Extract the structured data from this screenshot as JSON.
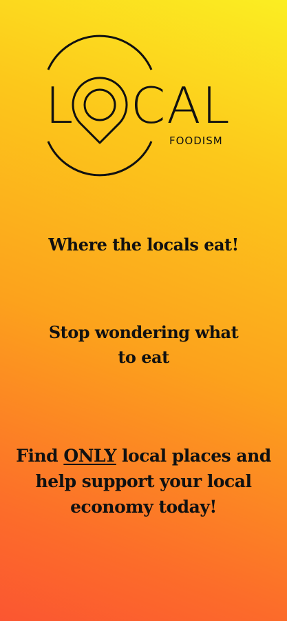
{
  "logo": {
    "letter_l": "L",
    "letters_cal": "CAL",
    "sub": "FOODISM"
  },
  "taglines": {
    "line1": "Where the locals eat!",
    "line2": "Stop wondering what to eat",
    "line3_pre": "Find ",
    "line3_emph": "ONLY",
    "line3_post": " local places and help support your local economy today!"
  },
  "colors": {
    "gradient_top": "#fbee22",
    "gradient_bottom": "#fb5631",
    "text": "#111111"
  },
  "icons": {
    "logo_o": "location-pin-icon"
  }
}
